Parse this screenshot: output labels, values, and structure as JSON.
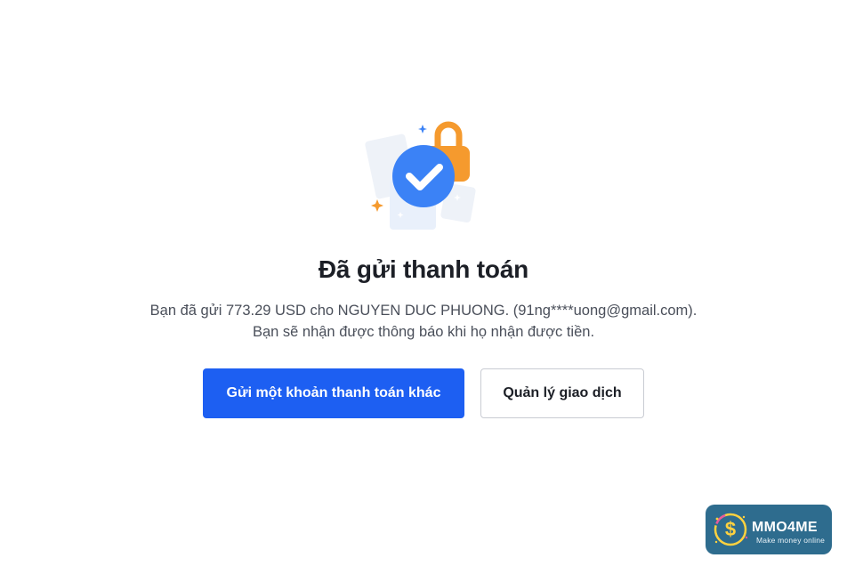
{
  "confirmation": {
    "icon": "payment-success-check-lock-icon",
    "title": "Đã gửi thanh toán",
    "message_line1": "Bạn đã gửi 773.29 USD cho NGUYEN DUC PHUONG. (91ng****uong@gmail.com).",
    "message_line2": "Bạn sẽ nhận được thông báo khi họ nhận được tiền."
  },
  "actions": {
    "send_another_label": "Gửi một khoản thanh toán khác",
    "manage_transactions_label": "Quản lý giao dịch"
  },
  "watermark": {
    "brand": "MMO4ME",
    "tagline": "Make money online",
    "logo_icon": "dollar-coin-logo-icon"
  },
  "colors": {
    "primary": "#1d5ff2",
    "check_circle": "#3b82f6",
    "lock": "#f59a2e",
    "title_text": "#1c1f26",
    "body_text": "#4a4f5a",
    "watermark_bg": "#2e6c8e"
  }
}
